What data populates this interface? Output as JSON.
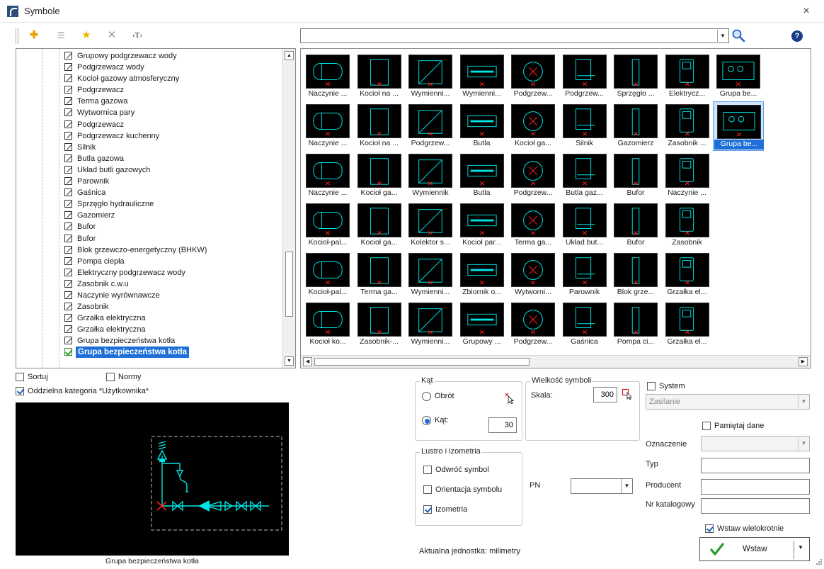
{
  "window": {
    "title": "Symbole",
    "close": "×"
  },
  "toolbar": {
    "add": "✚",
    "edit": "☰",
    "star": "★",
    "delete": "✕",
    "text": "‹T›"
  },
  "search": {
    "value": "",
    "placeholder": "",
    "dropdown": "▼",
    "help": "?"
  },
  "tree": {
    "items": [
      "Grupowy podgrzewacz wody",
      "Podgrzewacz wody",
      "Kocioł gazowy atmosferyczny",
      "Podgrzewacz",
      "Terma gazowa",
      "Wytwornica pary",
      "Podgrzewacz",
      "Podgrzewacz kuchenny",
      "Silnik",
      "Butla gazowa",
      "Układ butli gazowych",
      "Parownik",
      "Gaśnica",
      "Sprzęgło hydrauliczne",
      "Gazomierz",
      "Bufor",
      "Bufor",
      "Blok grzewczo-energetyczny (BHKW)",
      "Pompa ciepła",
      "Elektryczny podgrzewacz wody",
      "Zasobnik c.w.u",
      "Naczynie wyrównawcze",
      "Zasobnik",
      "Grzałka elektryczna",
      "Grzałka elektryczna",
      "Grupa bezpieczeństwa kotła",
      "Grupa bezpieczeństwa kotła"
    ],
    "selected_index": 26
  },
  "grid": {
    "symbols": [
      [
        "Naczynie ...",
        "Kocioł na ...",
        "Wymienni...",
        "Wymienni...",
        "Podgrzew...",
        "Podgrzew...",
        "Sprzęgło ...",
        "Elektrycz...",
        "Grupa be..."
      ],
      [
        "Naczynie ...",
        "Kocioł na ...",
        "Podgrzew...",
        "Butla",
        "Kocioł ga...",
        "Silnik",
        "Gazomierz",
        "Zasobnik ...",
        "Grupa be..."
      ],
      [
        "Naczynie ...",
        "Kocioł ga...",
        "Wymiennik",
        "Butla",
        "Podgrzew...",
        "Butla gaz...",
        "Bufor",
        "Naczynie ..."
      ],
      [
        "Kocioł-pal...",
        "Kocioł ga...",
        "Kolektor s...",
        "Kocioł par...",
        "Terma ga...",
        "Układ but...",
        "Bufor",
        "Zasobnik"
      ],
      [
        "Kocioł-pal...",
        "Terma ga...",
        "Wymienni...",
        "Zbiornik o...",
        "Wytworni...",
        "Parownik",
        "Blok grze...",
        "Grzałka el..."
      ],
      [
        "Kocioł ko...",
        "Zasobnik-...",
        "Wymienni...",
        "Grupowy ...",
        "Podgrzew...",
        "Gaśnica",
        "Pompa ci...",
        "Grzałka el..."
      ]
    ]
  },
  "options": {
    "sort": "Sortuj",
    "norms": "Normy",
    "user_category": "Oddzielna kategoria *Użytkownika*"
  },
  "preview": {
    "caption": "Grupa bezpieczeństwa kotła"
  },
  "angle": {
    "title": "Kąt",
    "rotation": "Obrót",
    "angle": "Kąt:",
    "angle_value": "30"
  },
  "size": {
    "title": "Wielkość symboli",
    "scale_label": "Skala:",
    "scale_value": "300"
  },
  "mirror": {
    "title": "Lustro i izometria",
    "flip": "Odwróć symbol",
    "orientation": "Orientacja symbolu",
    "isometry": "Izometria"
  },
  "pn": {
    "label": "PN",
    "value": ""
  },
  "system": {
    "label": "System",
    "placeholder": "Zasilanie"
  },
  "remember": "Pamiętaj dane",
  "fields": {
    "designation": "Oznaczenie",
    "type": "Typ",
    "producer": "Producent",
    "catalog": "Nr katalogowy"
  },
  "units": "Aktualna jednostka: milimetry",
  "insert_multiple": "Wstaw wielokrotnie",
  "insert": "Wstaw",
  "colors": {
    "symbol": "#00e5e5",
    "marker": "#ff2020",
    "select": "#1e6fd8"
  }
}
